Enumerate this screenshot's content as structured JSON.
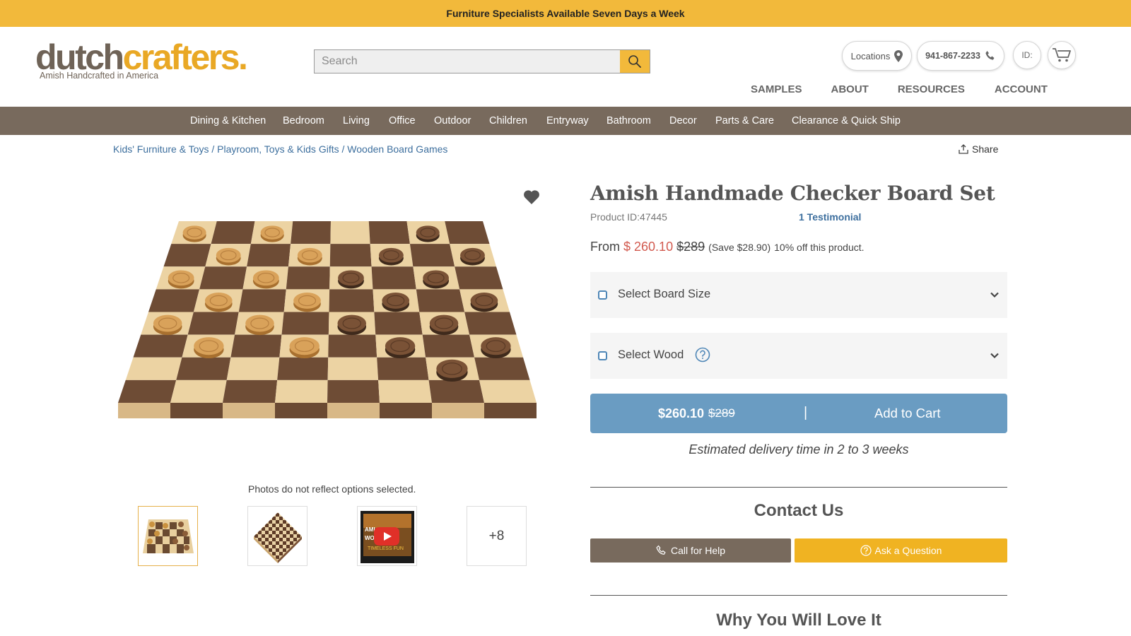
{
  "announcement": "Furniture Specialists Available Seven Days a Week",
  "logo": {
    "word_dark": "dutch",
    "word_light": "crafters.",
    "tagline": "Amish Handcrafted in America"
  },
  "search": {
    "placeholder": "Search",
    "value": ""
  },
  "header_pills": {
    "locations": "Locations",
    "phone": "941-867-2233",
    "id": "ID:"
  },
  "secondary_nav": [
    "SAMPLES",
    "ABOUT",
    "RESOURCES",
    "ACCOUNT"
  ],
  "categories": [
    "Dining & Kitchen",
    "Bedroom",
    "Living",
    "Office",
    "Outdoor",
    "Children",
    "Entryway",
    "Bathroom",
    "Decor",
    "Parts & Care",
    "Clearance & Quick Ship"
  ],
  "breadcrumb": [
    "Kids' Furniture & Toys",
    "Playroom, Toys & Kids Gifts",
    "Wooden Board Games"
  ],
  "breadcrumb_sep": " / ",
  "share_label": "Share",
  "gallery": {
    "note": "Photos do not reflect options selected.",
    "more_label": "+8",
    "video_text_1": "AMI",
    "video_text_2": "WO",
    "video_caption": "TIMELESS FUN"
  },
  "product": {
    "title": "Amish Handmade Checker Board Set",
    "product_id": "Product ID:47445",
    "testimonials": "1 Testimonial",
    "price_from_label": "From",
    "price_sale": "$ 260.10",
    "price_original": "$289",
    "savings": "(Save $28.90)",
    "discount_note": "10% off this product.",
    "options": [
      {
        "label": "Select Board Size"
      },
      {
        "label": "Select Wood"
      }
    ],
    "cart": {
      "price": "$260.10",
      "original": "$289",
      "separator": "|",
      "label": "Add to Cart"
    },
    "delivery": "Estimated delivery time in 2 to 3 weeks"
  },
  "contact": {
    "title": "Contact Us",
    "call_label": "Call for Help",
    "ask_label": "Ask a Question"
  },
  "why_title": "Why You Will Love It",
  "colors": {
    "topbar": "#f2b93b",
    "nav_bg": "#786a5d",
    "link": "#3d6f9e",
    "sale": "#d25a4f",
    "cart_btn": "#6a9cc2",
    "ask_btn": "#f0b322"
  }
}
